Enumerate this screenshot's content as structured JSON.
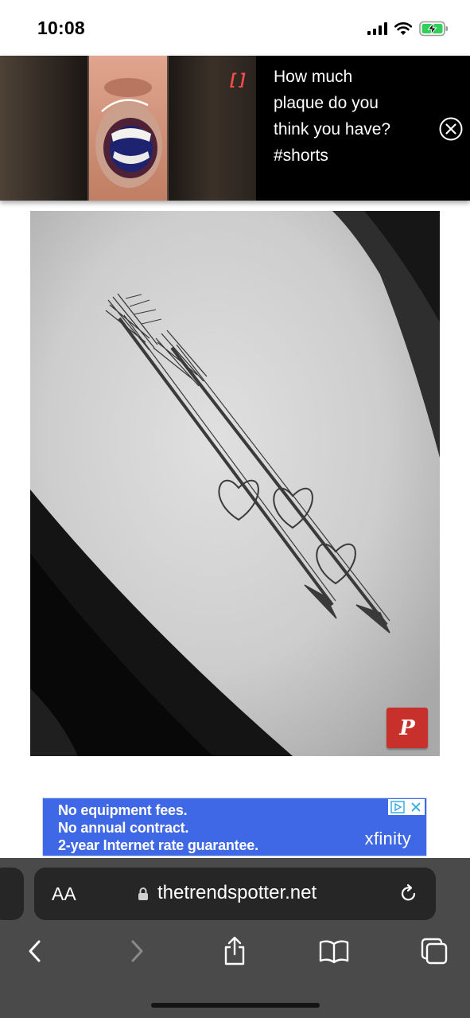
{
  "status_bar": {
    "time": "10:08",
    "icons": [
      "cellular-signal-icon",
      "wifi-icon",
      "battery-charging-icon"
    ],
    "battery_color": "#30d158"
  },
  "video_ad": {
    "bracket_text": "[]",
    "caption": "How much\nplaque do you\nthink you have?\n#shorts",
    "close_icon": "close-circle-icon"
  },
  "article_image": {
    "subject": "arrow-tattoo-photo",
    "pin_button_label": "P",
    "pin_icon": "pinterest-icon",
    "pin_color": "#c8312b"
  },
  "banner_ad": {
    "lines": [
      "No equipment fees.",
      "No annual contract.",
      "2-year Internet rate guarantee."
    ],
    "brand": "xfinity",
    "background_color": "#3f68e6",
    "adchoices_icons": [
      "adchoices-play-icon",
      "adchoices-close-icon"
    ]
  },
  "browser": {
    "aa_label": "AA",
    "url": "thetrendspotter.net",
    "reload_icon": "reload-icon",
    "toolbar": [
      "back-icon",
      "forward-icon",
      "share-icon",
      "bookmarks-icon",
      "tabs-icon"
    ]
  }
}
